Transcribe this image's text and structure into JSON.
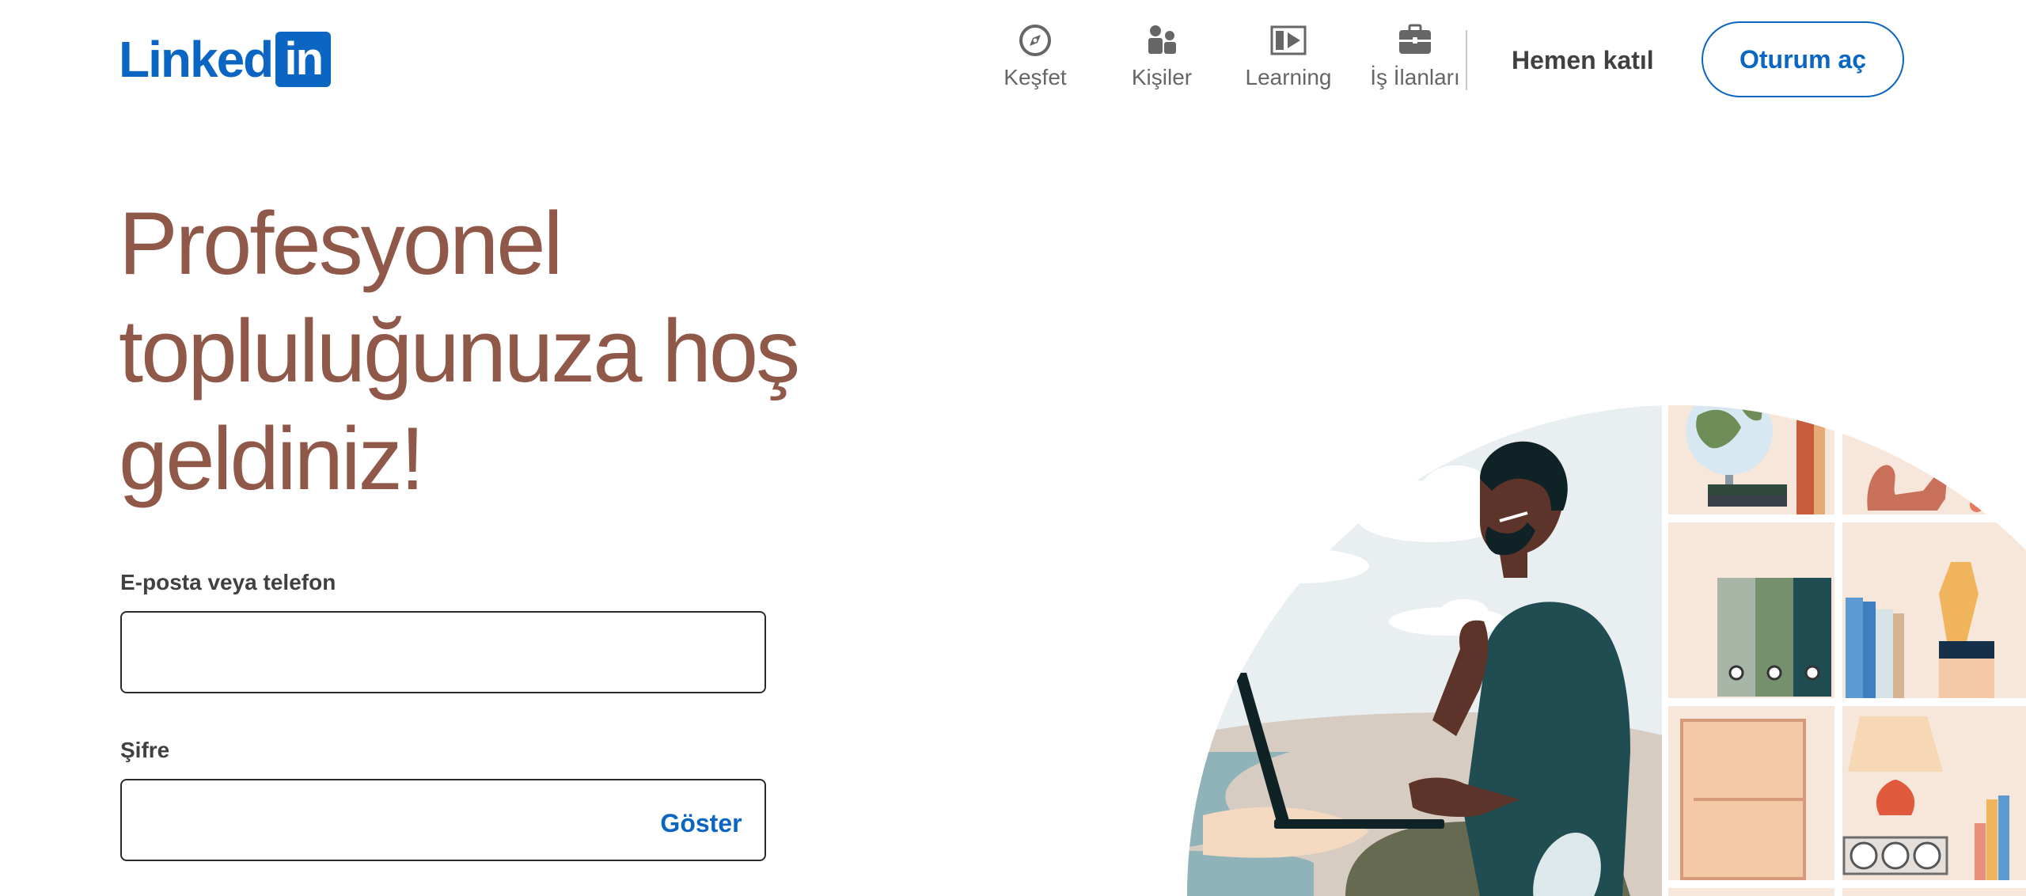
{
  "brand": {
    "logo_text": "Linked",
    "logo_box": "in",
    "color": "#0a66c2"
  },
  "nav": {
    "items": [
      {
        "label": "Keşfet",
        "icon": "compass-icon"
      },
      {
        "label": "Kişiler",
        "icon": "people-icon"
      },
      {
        "label": "Learning",
        "icon": "video-player-icon"
      },
      {
        "label": "İş İlanları",
        "icon": "briefcase-icon"
      }
    ],
    "join_label": "Hemen katıl",
    "signin_label": "Oturum aç"
  },
  "hero": {
    "headline_lines": [
      "Profesyonel",
      "topluluğunuza hoş",
      "geldiniz!"
    ]
  },
  "form": {
    "email_label": "E-posta veya telefon",
    "email_value": "",
    "password_label": "Şifre",
    "password_value": "",
    "show_label": "Göster"
  },
  "colors": {
    "accent": "#0a66c2",
    "headline": "#8f5849",
    "text": "#404040",
    "muted": "#666666"
  }
}
